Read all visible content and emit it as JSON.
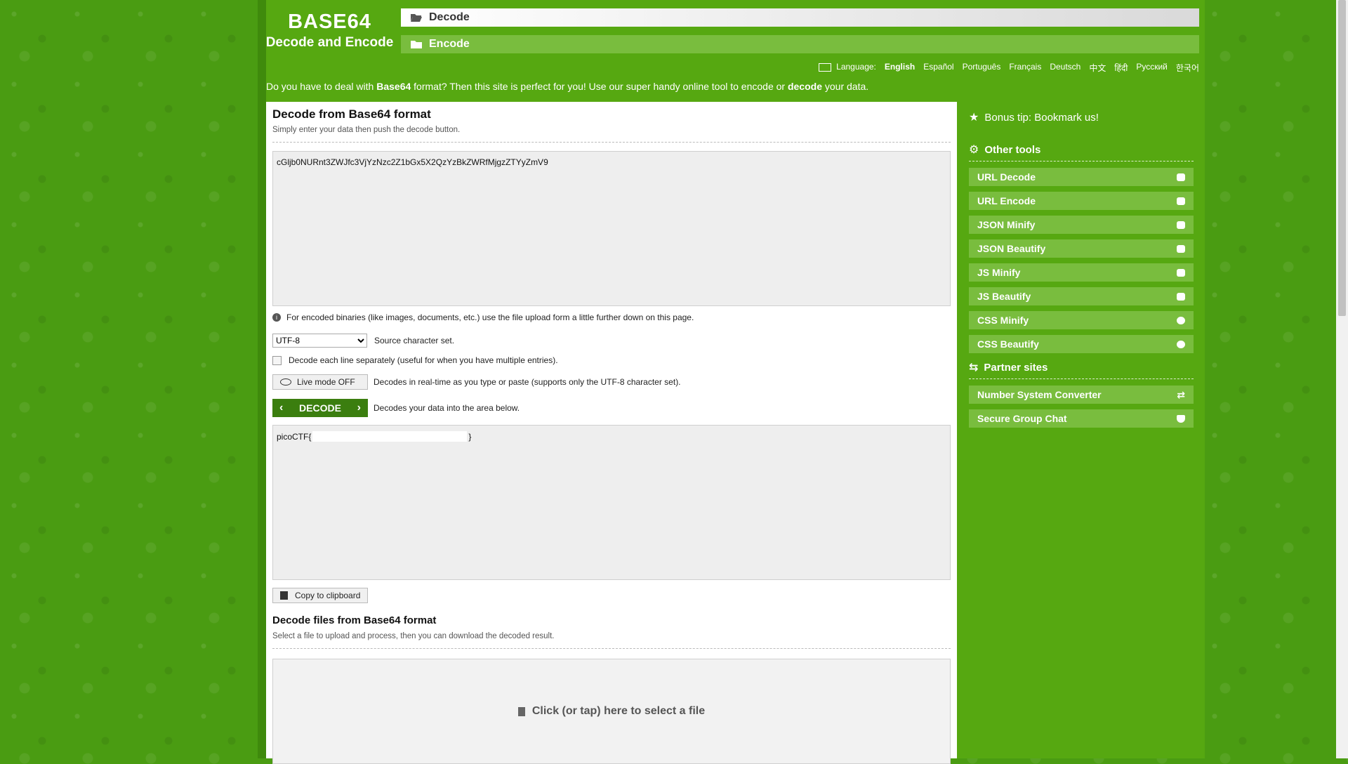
{
  "logo": {
    "title": "BASE64",
    "subtitle": "Decode and Encode"
  },
  "tabs": {
    "decode": "Decode",
    "encode": "Encode"
  },
  "language": {
    "label": "Language:",
    "options": [
      "English",
      "Español",
      "Português",
      "Français",
      "Deutsch",
      "中文",
      "हिंदी",
      "Русский",
      "한국어"
    ]
  },
  "intro": {
    "p1": "Do you have to deal with ",
    "b1": "Base64",
    "p2": " format? Then this site is perfect for you! Use our super handy online tool to encode or ",
    "b2": "decode",
    "p3": " your data."
  },
  "main": {
    "title": "Decode from Base64 format",
    "subtitle": "Simply enter your data then push the decode button.",
    "input_value": "cGljb0NURnt3ZWJfc3VjYzNzc2Z1bGx5X2QzYzBkZWRfMjgzZTYyZmV9",
    "binary_note": "For encoded binaries (like images, documents, etc.) use the file upload form a little further down on this page.",
    "charset_selected": "UTF-8",
    "charset_label": "Source character set.",
    "each_line_label": "Decode each line separately (useful for when you have multiple entries).",
    "live_mode_button": "Live mode OFF",
    "live_mode_desc": "Decodes in real-time as you type or paste (supports only the UTF-8 character set).",
    "decode_button": "DECODE",
    "decode_desc": "Decodes your data into the area below.",
    "output_prefix": "picoCTF{",
    "output_suffix": "}",
    "copy_button": "Copy to clipboard",
    "files_title": "Decode files from Base64 format",
    "files_subtitle": "Select a file to upload and process, then you can download the decoded result.",
    "upload_label": "Click (or tap) here to select a file"
  },
  "sidebar": {
    "bonus_tip": "Bonus tip: Bookmark us!",
    "other_tools_title": "Other tools",
    "tools": [
      "URL Decode",
      "URL Encode",
      "JSON Minify",
      "JSON Beautify",
      "JS Minify",
      "JS Beautify",
      "CSS Minify",
      "CSS Beautify"
    ],
    "partner_title": "Partner sites",
    "partners": [
      "Number System Converter",
      "Secure Group Chat"
    ]
  }
}
